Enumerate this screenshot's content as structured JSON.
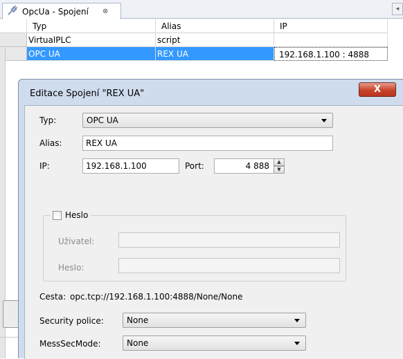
{
  "tab": {
    "label": "OpcUa - Spojení",
    "close_glyph": "⊗",
    "icon": "connection-plug-icon"
  },
  "table": {
    "columns": [
      "Typ",
      "Alias",
      "IP"
    ],
    "rows": [
      {
        "typ": "VirtualPLC",
        "alias": "script",
        "ip": ""
      },
      {
        "typ": "OPC UA",
        "alias": "REX UA",
        "ip": "192.168.1.100 : 4888",
        "selected": true
      }
    ]
  },
  "dialog": {
    "title": "Editace Spojení \"REX UA\"",
    "close_glyph": "X",
    "typ": {
      "label": "Typ:",
      "value": "OPC UA"
    },
    "alias": {
      "label": "Alias:",
      "value": "REX UA"
    },
    "ip": {
      "label": "IP:",
      "value": "192.168.1.100"
    },
    "port": {
      "label": "Port:",
      "value": "4 888"
    },
    "password_group": {
      "checkbox_label": "Heslo",
      "checked": false,
      "user_label": "Uživatel:",
      "user_value": "",
      "password_label": "Heslo:",
      "password_value": ""
    },
    "path_label": "Cesta:",
    "path_value": "opc.tcp://192.168.1.100:4888/None/None",
    "security_policy": {
      "label": "Security police:",
      "value": "None"
    },
    "mess_sec_mode": {
      "label": "MessSecMode:",
      "value": "None"
    }
  },
  "colors": {
    "selection": "#3399ff",
    "dialog_frame": "#cfdcee",
    "close_button": "#c7432c"
  }
}
